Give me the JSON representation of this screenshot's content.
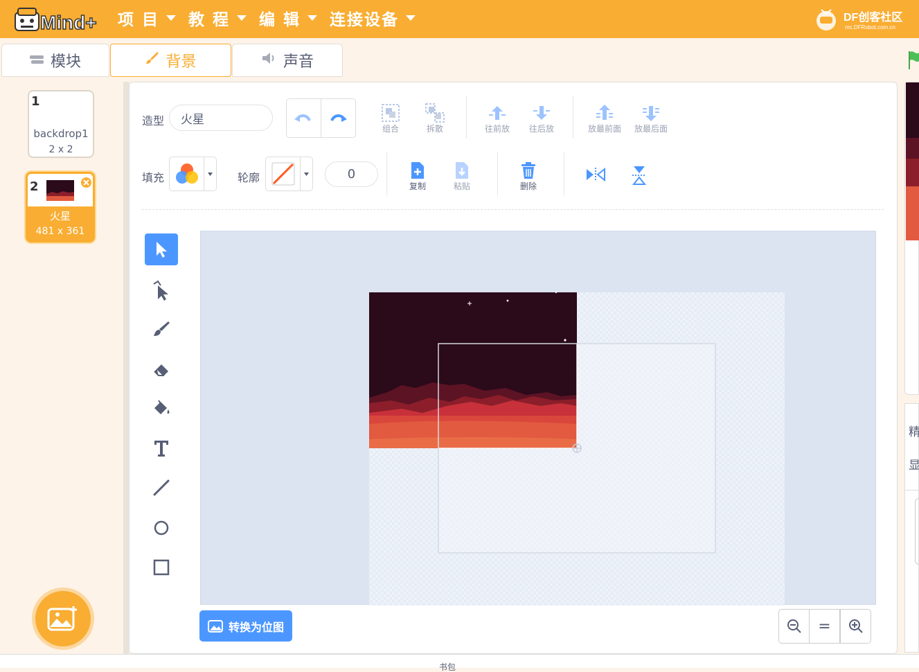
{
  "app": {
    "logo_text": "Mind+"
  },
  "menu": [
    {
      "label": "项 目"
    },
    {
      "label": "教 程"
    },
    {
      "label": "编 辑"
    },
    {
      "label": "连接设备"
    }
  ],
  "brand": {
    "name": "DF创客社区",
    "url": "mc.DFRobot.com.cn"
  },
  "tabs": {
    "blocks": "模块",
    "backdrops": "背景",
    "sounds": "声音"
  },
  "costumes": [
    {
      "index": "1",
      "name": "backdrop1",
      "size": "2 x 2"
    },
    {
      "index": "2",
      "name": "火星",
      "size": "481 x 361"
    }
  ],
  "editor": {
    "costume_label": "造型",
    "costume_name": "火星",
    "fill_label": "填充",
    "outline_label": "轮廓",
    "outline_width": "0",
    "buttons": {
      "group": "组合",
      "ungroup": "拆散",
      "forward": "往前放",
      "backward": "往后放",
      "front": "放最前面",
      "back": "放最后面",
      "copy": "复制",
      "paste": "粘贴",
      "delete": "删除"
    },
    "convert_label": "转换为位图",
    "zoom_reset": "="
  },
  "sprite_info": {
    "label_a": "精",
    "label_b": "显"
  },
  "bottom": {
    "text": "书包"
  },
  "colors": {
    "accent": "#f9ad32",
    "blue": "#4c97ff",
    "sky": "#2b0a1a",
    "mars_dark": "#8b1e2a",
    "mars_red": "#c8313a",
    "mars_orange": "#e25a3f"
  }
}
